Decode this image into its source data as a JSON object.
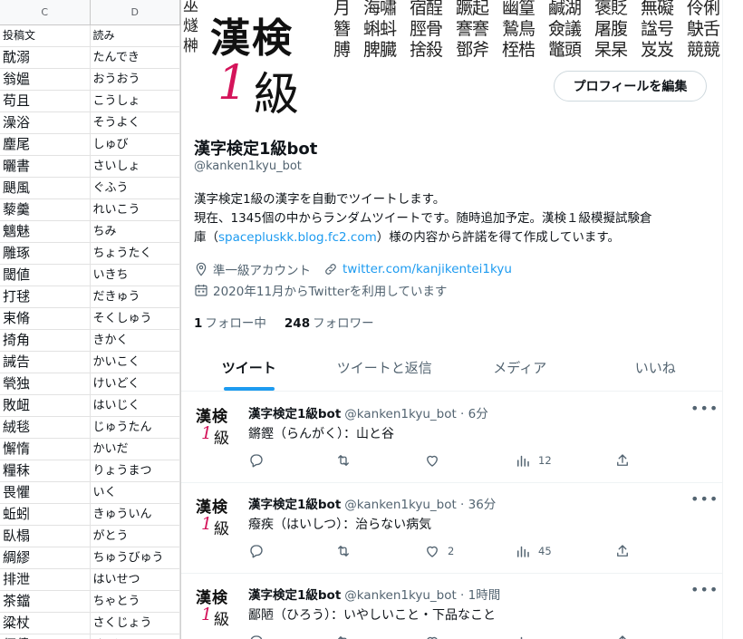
{
  "sheet": {
    "col_c": "C",
    "col_d": "D",
    "rows": [
      {
        "c": "投稿文",
        "d": "読み"
      },
      {
        "c": "酖溺",
        "d": "たんでき"
      },
      {
        "c": "翁媼",
        "d": "おうおう"
      },
      {
        "c": "苟且",
        "d": "こうしょ"
      },
      {
        "c": "澡浴",
        "d": "そうよく"
      },
      {
        "c": "麈尾",
        "d": "しゅび"
      },
      {
        "c": "曬書",
        "d": "さいしょ"
      },
      {
        "c": "颶風",
        "d": "ぐふう"
      },
      {
        "c": "藜羹",
        "d": "れいこう"
      },
      {
        "c": "魑魅",
        "d": "ちみ"
      },
      {
        "c": "雕琢",
        "d": "ちょうたく"
      },
      {
        "c": "閾値",
        "d": "いきち"
      },
      {
        "c": "打毬",
        "d": "だきゅう"
      },
      {
        "c": "束脩",
        "d": "そくしゅう"
      },
      {
        "c": "掎角",
        "d": "きかく"
      },
      {
        "c": "誡告",
        "d": "かいこく"
      },
      {
        "c": "煢独",
        "d": "けいどく"
      },
      {
        "c": "敗衄",
        "d": "はいじく"
      },
      {
        "c": "絨毯",
        "d": "じゅうたん"
      },
      {
        "c": "懈惰",
        "d": "かいだ"
      },
      {
        "c": "糧秣",
        "d": "りょうまつ"
      },
      {
        "c": "畏懼",
        "d": "いく"
      },
      {
        "c": "蚯蚓",
        "d": "きゅういん"
      },
      {
        "c": "臥榻",
        "d": "がとう"
      },
      {
        "c": "綢繆",
        "d": "ちゅうびゅう"
      },
      {
        "c": "排泄",
        "d": "はいせつ"
      },
      {
        "c": "茶鐺",
        "d": "ちゃとう"
      },
      {
        "c": "粱杖",
        "d": "さくじょう"
      },
      {
        "c": "傴僂",
        "d": "く る"
      }
    ]
  },
  "banner": {
    "left_col": [
      "巫蠱",
      "燧石",
      "榊"
    ],
    "cells": [
      "霽月",
      "海嘯",
      "宿酲",
      "蹶起",
      "幽篁",
      "鹹湖",
      "褒貶",
      "無礙",
      "伶俐",
      "盍簪",
      "蝌蚪",
      "脛骨",
      "謇謇",
      "鷙鳥",
      "僉議",
      "屠腹",
      "諡号",
      "鴃舌",
      "上膊",
      "脾臓",
      "捨殺",
      "鄧斧",
      "桎梏",
      "鼈頭",
      "杲杲",
      "岌岌",
      "競競"
    ]
  },
  "avatar": {
    "kanji": "漢検",
    "one": "1",
    "kyu": "級"
  },
  "profile": {
    "edit_button": "プロフィールを編集",
    "name": "漢字検定1級bot",
    "handle": "@kanken1kyu_bot",
    "bio_line1": "漢字検定1級の漢字を自動でツイートします。",
    "bio_line2": "現在、1345個の中からランダムツイートです。随時追加予定。漢検１級模擬試験倉",
    "bio_line3_pre": "庫（",
    "bio_link": "spacepluskk.blog.fc2.com",
    "bio_line3_post": "）様の内容から許諾を得て作成しています。",
    "location": "準一級アカウント",
    "url": "twitter.com/kanjikentei1kyu",
    "joined": "2020年11月からTwitterを利用しています",
    "following_count": "1",
    "following_label": "フォロー中",
    "followers_count": "248",
    "followers_label": "フォロワー"
  },
  "tabs": [
    {
      "label": "ツイート"
    },
    {
      "label": "ツイートと返信"
    },
    {
      "label": "メディア"
    },
    {
      "label": "いいね"
    }
  ],
  "tweets": [
    {
      "name": "漢字検定1級bot",
      "handle_time": "@kanken1kyu_bot · 6分",
      "body": "鏘鏗（らんがく）：山と谷",
      "likes": "",
      "views": "12"
    },
    {
      "name": "漢字検定1級bot",
      "handle_time": "@kanken1kyu_bot · 36分",
      "body": "癈疾（はいしつ）：治らない病気",
      "likes": "2",
      "views": "45"
    },
    {
      "name": "漢字検定1級bot",
      "handle_time": "@kanken1kyu_bot · 1時間",
      "body": "鄙陋（ひろう）：いやしいこと・下品なこと",
      "likes": "",
      "views": ""
    }
  ],
  "colors": {
    "accent": "#1d9bf0",
    "brand_red": "#d4145a",
    "muted": "#536471"
  },
  "icons": [
    "location-icon",
    "link-icon",
    "calendar-icon",
    "reply-icon",
    "retweet-icon",
    "like-icon",
    "views-icon",
    "share-icon",
    "more-icon"
  ]
}
